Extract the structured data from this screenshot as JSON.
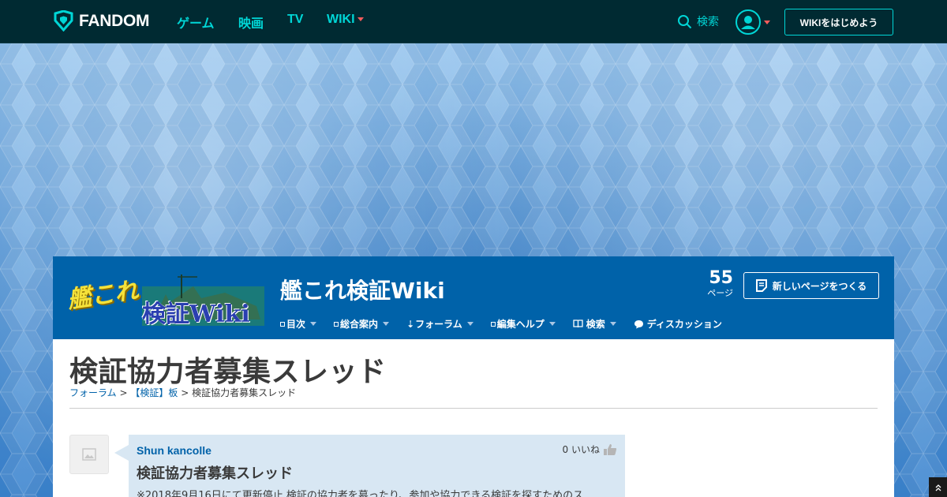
{
  "global_nav": {
    "logo_text": "FANDOM",
    "links": [
      {
        "label": "ゲーム"
      },
      {
        "label": "映画"
      },
      {
        "label": "TV"
      },
      {
        "label": "WIKI"
      }
    ],
    "search_label": "検索",
    "start_wiki_label": "WIKIをはじめよう"
  },
  "wiki_header": {
    "logo_text_top": "艦これ",
    "logo_text_bottom": "検証Wiki",
    "title": "艦これ検証Wiki",
    "page_count": "55",
    "page_count_label": "ページ",
    "new_page_label": "新しいページをつくる",
    "nav": [
      {
        "label": "目次",
        "icon": "square-icon"
      },
      {
        "label": "総合案内",
        "icon": "square-icon"
      },
      {
        "label": "フォーラム",
        "icon": "arrow-icon"
      },
      {
        "label": "編集ヘルプ",
        "icon": "square-icon"
      },
      {
        "label": "検索",
        "icon": "book-icon"
      },
      {
        "label": "ディスカッション",
        "icon": "chat-icon"
      }
    ]
  },
  "page": {
    "title": "検証協力者募集スレッド",
    "breadcrumb": {
      "forum": "フォーラム",
      "sep1": ">",
      "board": "【検証】板",
      "sep2": ">",
      "current": "検証協力者募集スレッド"
    }
  },
  "post": {
    "author": "Shun kancolle",
    "likes": "0 いいね",
    "title": "検証協力者募集スレッド",
    "body": "※2018年9月16日にて更新停止 検証の協力者を募ったり、参加や協力できる検証を探すためのス"
  },
  "colors": {
    "global_nav_bg": "#002a32",
    "accent": "#00d6d6",
    "wiki_header_bg": "#0062a9",
    "post_bg": "#d8e7f3",
    "link": "#0062a9"
  }
}
